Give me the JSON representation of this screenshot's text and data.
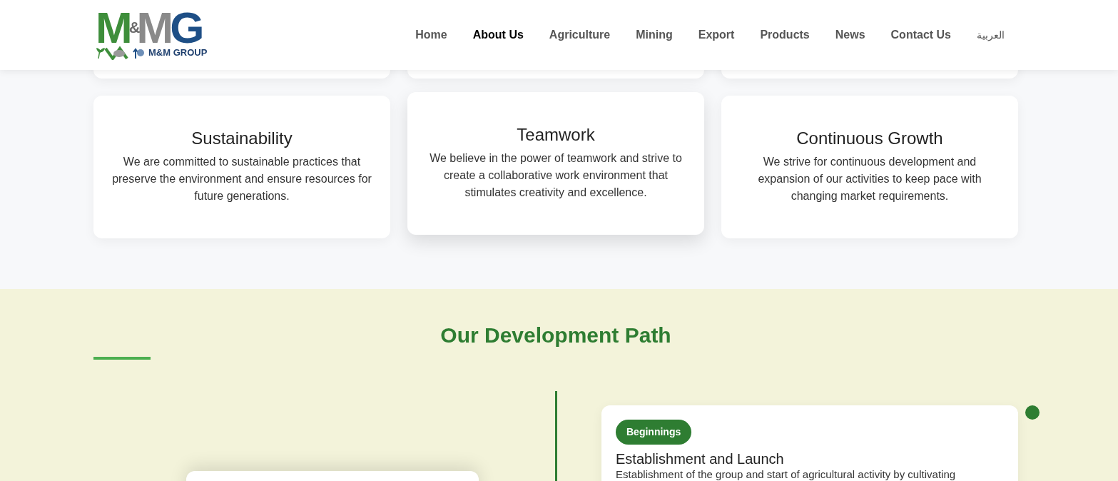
{
  "header": {
    "logo": {
      "monogram": [
        "M",
        "&",
        "M",
        "G"
      ],
      "wordmark": "M&M GROUP"
    },
    "nav": [
      {
        "label": "Home",
        "selected": false
      },
      {
        "label": "About Us",
        "selected": true
      },
      {
        "label": "Agriculture",
        "selected": false
      },
      {
        "label": "Mining",
        "selected": false
      },
      {
        "label": "Export",
        "selected": false
      },
      {
        "label": "Products",
        "selected": false
      },
      {
        "label": "News",
        "selected": false
      },
      {
        "label": "Contact Us",
        "selected": false
      },
      {
        "label": "العربية",
        "selected": false
      }
    ]
  },
  "values": [
    {
      "title": "Sustainability",
      "text": "We are committed to sustainable practices that preserve the environment and ensure resources for future generations.",
      "hovered": false
    },
    {
      "title": "Teamwork",
      "text": "We believe in the power of teamwork and strive to create a collaborative work environment that stimulates creativity and excellence.",
      "hovered": true
    },
    {
      "title": "Continuous Growth",
      "text": "We strive for continuous development and expansion of our activities to keep pace with changing market requirements.",
      "hovered": false
    }
  ],
  "development": {
    "title": "Our Development Path",
    "timeline": [
      {
        "badge": "Beginnings",
        "title": "Establishment and Launch",
        "text": "Establishment of the group and start of agricultural activity by cultivating"
      }
    ]
  }
}
